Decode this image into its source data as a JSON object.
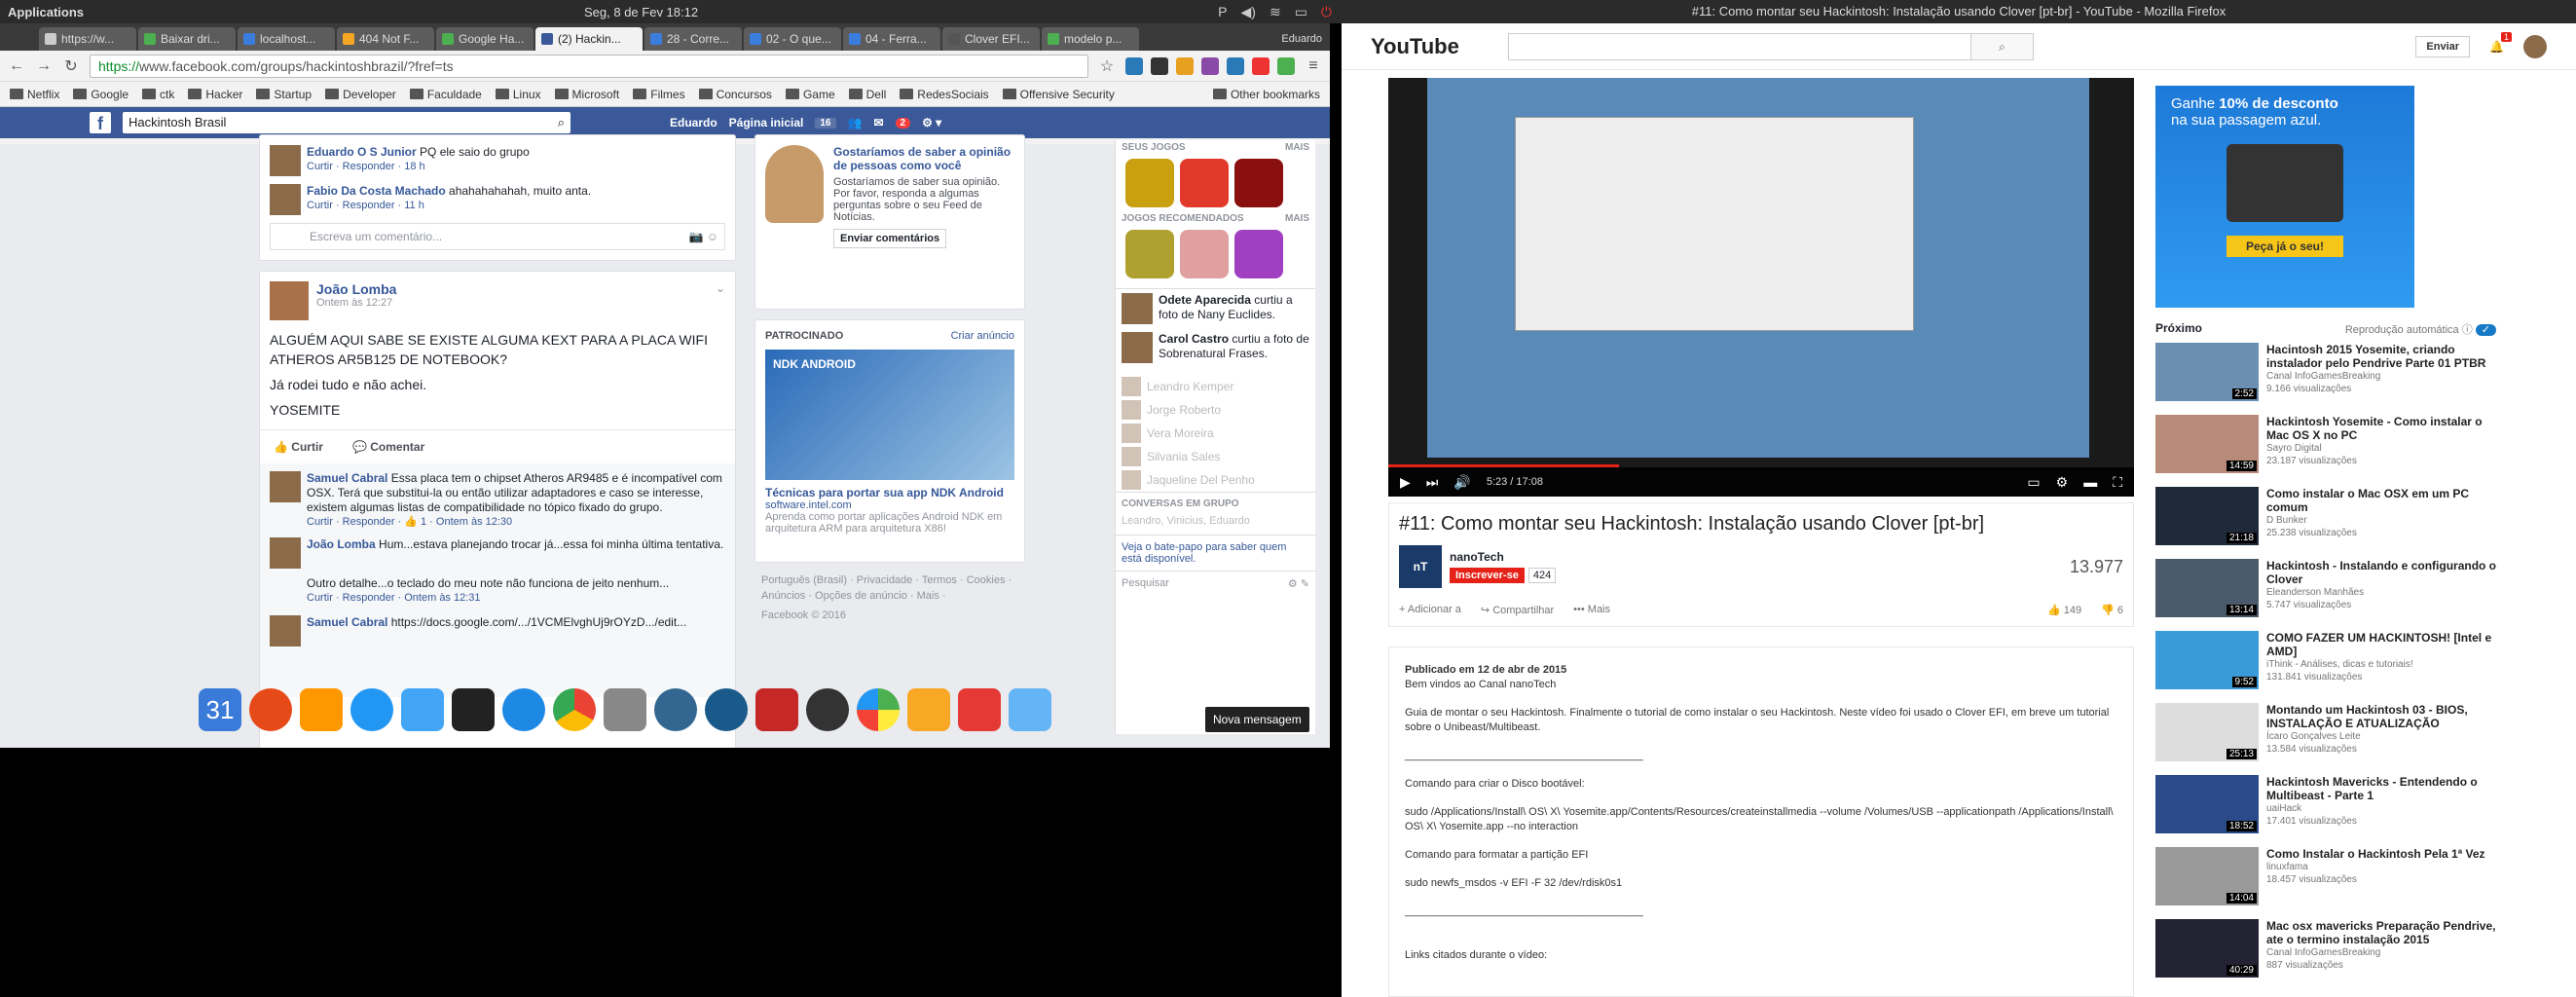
{
  "topbar": {
    "applications": "Applications",
    "clock": "Seg, 8 de Fev  18:12"
  },
  "chrome": {
    "tabs": [
      {
        "label": "https://w...",
        "color": "#ccc"
      },
      {
        "label": "Baixar dri...",
        "color": "#4caf50"
      },
      {
        "label": "localhost...",
        "color": "#3b7ddd"
      },
      {
        "label": "404 Not F...",
        "color": "#f5a623"
      },
      {
        "label": "Google Ha...",
        "color": "#4caf50"
      },
      {
        "label": "(2) Hackin...",
        "color": "#3b5998",
        "active": true
      },
      {
        "label": "28 - Corre...",
        "color": "#3b7ddd"
      },
      {
        "label": "02 - O que...",
        "color": "#3b7ddd"
      },
      {
        "label": "04 - Ferra...",
        "color": "#3b7ddd"
      },
      {
        "label": "Clover EFI...",
        "color": "#555"
      },
      {
        "label": "modelo p...",
        "color": "#4caf50"
      }
    ],
    "user": "Eduardo",
    "url_scheme": "https://",
    "url_rest": "www.facebook.com/groups/hackintoshbrazil/?fref=ts",
    "bookmarks": [
      "Netflix",
      "Google",
      "ctk",
      "Hacker",
      "Startup",
      "Developer",
      "Faculdade",
      "Linux",
      "Microsoft",
      "Filmes",
      "Concursos",
      "Game",
      "Dell",
      "RedesSociais",
      "Offensive Security"
    ],
    "other_bookmarks": "Other bookmarks"
  },
  "facebook": {
    "search": "Hackintosh Brasil",
    "user": "Eduardo",
    "home": "Página inicial",
    "home_count": "16",
    "notif_count": "2",
    "top_comments": [
      {
        "name": "Eduardo O S Junior",
        "text": "PQ ele saio do grupo",
        "actions": "Curtir · Responder · 18 h"
      },
      {
        "name": "Fabio Da Costa Machado",
        "text": "ahahahahahah, muito anta.",
        "actions": "Curtir · Responder · 11 h"
      }
    ],
    "comment_placeholder": "Escreva um comentário...",
    "post": {
      "author": "João Lomba",
      "time": "Ontem às 12:27",
      "text1": "ALGUÉM AQUI SABE SE EXISTE ALGUMA KEXT PARA A PLACA WIFI ATHEROS AR5B125 DE NOTEBOOK?",
      "text2": "Já rodei tudo e não achei.",
      "text3": "YOSEMITE",
      "like": "Curtir",
      "comment": "Comentar"
    },
    "post_comments": [
      {
        "name": "Samuel Cabral",
        "text": "Essa placa tem o chipset Atheros AR9485 e é incompatível com OSX. Terá que substitui-la ou então utilizar adaptadores e caso se interesse, existem algumas listas de compatibilidade no tópico fixado do grupo.",
        "actions": "Curtir · Responder · 👍 1 · Ontem às 12:30"
      },
      {
        "name": "João Lomba",
        "text": "Hum...estava planejando trocar já...essa foi minha última tentativa.",
        "actions": ""
      },
      {
        "name": "",
        "text": "Outro detalhe...o teclado do meu note não funciona de jeito nenhum...",
        "actions": "Curtir · Responder · Ontem às 12:31"
      },
      {
        "name": "Samuel Cabral",
        "text": "https://docs.google.com/.../1VCMElvghUj9rOYzD.../edit...",
        "actions": ""
      }
    ],
    "survey": {
      "title": "Gostaríamos de saber a opinião de pessoas como você",
      "body": "Gostaríamos de saber sua opinião. Por favor, responda a algumas perguntas sobre o seu Feed de Notícias.",
      "button": "Enviar comentários"
    },
    "sponsored": {
      "label": "PATROCINADO",
      "create": "Criar anúncio",
      "ad_image": "NDK ANDROID",
      "ad_title": "Técnicas para portar sua app NDK Android",
      "ad_domain": "software.intel.com",
      "ad_body": "Aprenda como portar aplicações Android NDK em arquitetura ARM para arquitetura X86!"
    },
    "footer": "Português (Brasil) · Privacidade · Termos · Cookies · Anúncios · Opções de anúncio · Mais ·",
    "copyright": "Facebook © 2016",
    "games": {
      "my": "SEUS JOGOS",
      "more": "MAIS",
      "rec": "JOGOS RECOMENDADOS"
    },
    "ticker": [
      {
        "name": "Odete Aparecida",
        "text": "curtiu a foto de Nany Euclides."
      },
      {
        "name": "Carol Castro",
        "text": "curtiu a foto de Sobrenatural Frases."
      }
    ],
    "chat": [
      "Leandro Kemper",
      "Jorge Roberto",
      "Vera Moreira",
      "Silvania Sales",
      "Jaqueline Del Penho"
    ],
    "group_convos": "CONVERSAS EM GRUPO",
    "group_names": "Leandro, Vinicius, Eduardo",
    "chat_hint": "Veja o bate-papo para saber quem está disponível.",
    "search_chat": "Pesquisar",
    "tooltip": "Nova mensagem"
  },
  "dock_calendar": "31",
  "youtube": {
    "window_title": "#11: Como montar seu Hackintosh: Instalação usando Clover [pt-br] - YouTube - Mozilla Firefox",
    "logo": "YouTube",
    "upload": "Enviar",
    "notif": "1",
    "time": "5:23 / 17:08",
    "video_title": "#11: Como montar seu Hackintosh: Instalação usando Clover [pt-br]",
    "channel": "nanoTech",
    "subscribe": "Inscrever-se",
    "subs": "424",
    "views": "13.977",
    "add": "Adicionar a",
    "share": "Compartilhar",
    "more": "Mais",
    "likes": "149",
    "dislikes": "6",
    "published": "Publicado em 12 de abr de 2015",
    "welcome": "Bem vindos ao Canal nanoTech",
    "desc1": "Guia de montar o seu Hackintosh. Finalmente o tutorial de como instalar o seu Hackintosh. Neste vídeo foi usado o Clover EFI, em breve um tutorial sobre o Unibeast/Multibeast.",
    "divider": "________________________________________",
    "cmd_title": "Comando para criar o Disco bootável:",
    "cmd": "sudo /Applications/Install\\ OS\\ X\\ Yosemite.app/Contents/Resources/createinstallmedia --volume /Volumes/USB --applicationpath /Applications/Install\\ OS\\ X\\ Yosemite.app --no interaction",
    "fmt_title": "Comando para formatar a partição EFI",
    "fmt": "sudo newfs_msdos -v EFI -F 32 /dev/rdisk0s1",
    "links": "Links citados durante o vídeo:",
    "ad": {
      "line1": "Ganhe",
      "bold": "10% de desconto",
      "line2": "na sua passagem azul.",
      "cta": "Peça já o seu!"
    },
    "next": "Próximo",
    "autoplay": "Reprodução automática",
    "recs": [
      {
        "title": "Hacintosh 2015 Yosemite, criando instalador pelo Pendrive Parte 01 PTBR",
        "channel": "Canal InfoGamesBreaking",
        "views": "9.166 visualizações",
        "dur": "2:52",
        "color": "#6a8fb0"
      },
      {
        "title": "Hackintosh Yosemite - Como instalar o Mac OS X no PC",
        "channel": "Sayro Digital",
        "views": "23.187 visualizações",
        "dur": "14:59",
        "color": "#b88a7a"
      },
      {
        "title": "Como instalar o Mac OSX em um PC comum",
        "channel": "D Bunker",
        "views": "25.238 visualizações",
        "dur": "21:18",
        "color": "#1e2a3a"
      },
      {
        "title": "Hackintosh - Instalando e configurando o Clover",
        "channel": "Eleanderson Manhães",
        "views": "5.747 visualizações",
        "dur": "13:14",
        "color": "#4a5a6a"
      },
      {
        "title": "COMO FAZER UM HACKINTOSH! [Intel e AMD]",
        "channel": "iThink - Análises, dicas e tutoriais!",
        "views": "131.841 visualizações",
        "dur": "9:52",
        "color": "#3a9ad8"
      },
      {
        "title": "Montando um Hackintosh 03 - BIOS, INSTALAÇÃO E ATUALIZAÇÃO",
        "channel": "Ícaro Gonçalves Leite",
        "views": "13.584 visualizações",
        "dur": "25:13",
        "color": "#ddd"
      },
      {
        "title": "Hackintosh Mavericks - Entendendo o Multibeast - Parte 1",
        "channel": "uaiHack",
        "views": "17.401 visualizações",
        "dur": "18:52",
        "color": "#2a4a8a"
      },
      {
        "title": "Como Instalar o Hackintosh Pela 1ª Vez",
        "channel": "linuxfama",
        "views": "18.457 visualizações",
        "dur": "14:04",
        "color": "#999"
      },
      {
        "title": "Mac osx mavericks Preparação Pendrive, ate o termino instalação 2015",
        "channel": "Canal InfoGamesBreaking",
        "views": "887 visualizações",
        "dur": "40:29",
        "color": "#223"
      }
    ]
  }
}
